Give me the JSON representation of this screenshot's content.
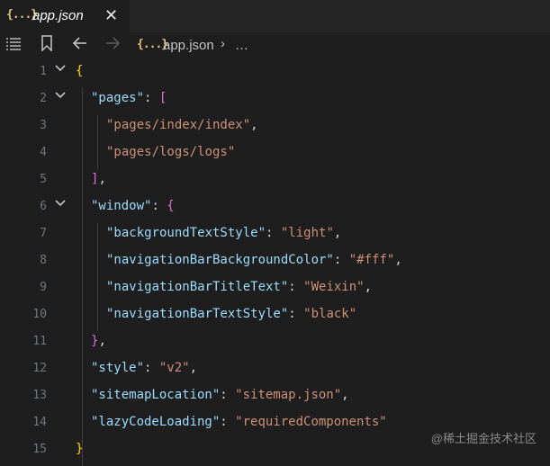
{
  "tab": {
    "icon": "{...}",
    "title": "app.json",
    "close": "✕"
  },
  "breadcrumb": {
    "icon": "{...}",
    "file": "app.json",
    "separator": "›",
    "more": "…"
  },
  "colors": {
    "background": "#1e1e1e",
    "key": "#9cdcfe",
    "string": "#ce9178",
    "bracket_gold": "#ffd700",
    "bracket_purple": "#da70d6",
    "line_number": "#6e7681"
  },
  "lines": [
    {
      "n": "1",
      "fold": true,
      "indent": 0,
      "parts": [
        {
          "t": "{",
          "c": "br1"
        }
      ]
    },
    {
      "n": "2",
      "fold": true,
      "indent": 1,
      "parts": [
        {
          "t": "\"pages\"",
          "c": "key"
        },
        {
          "t": ": ",
          "c": "punc"
        },
        {
          "t": "[",
          "c": "br2"
        }
      ]
    },
    {
      "n": "3",
      "fold": false,
      "indent": 2,
      "parts": [
        {
          "t": "\"pages/index/index\"",
          "c": "str"
        },
        {
          "t": ",",
          "c": "punc"
        }
      ]
    },
    {
      "n": "4",
      "fold": false,
      "indent": 2,
      "parts": [
        {
          "t": "\"pages/logs/logs\"",
          "c": "str"
        }
      ]
    },
    {
      "n": "5",
      "fold": false,
      "indent": 1,
      "parts": [
        {
          "t": "]",
          "c": "br2"
        },
        {
          "t": ",",
          "c": "punc"
        }
      ]
    },
    {
      "n": "6",
      "fold": true,
      "indent": 1,
      "parts": [
        {
          "t": "\"window\"",
          "c": "key"
        },
        {
          "t": ": ",
          "c": "punc"
        },
        {
          "t": "{",
          "c": "br2"
        }
      ]
    },
    {
      "n": "7",
      "fold": false,
      "indent": 2,
      "parts": [
        {
          "t": "\"backgroundTextStyle\"",
          "c": "key"
        },
        {
          "t": ": ",
          "c": "punc"
        },
        {
          "t": "\"light\"",
          "c": "str"
        },
        {
          "t": ",",
          "c": "punc"
        }
      ]
    },
    {
      "n": "8",
      "fold": false,
      "indent": 2,
      "parts": [
        {
          "t": "\"navigationBarBackgroundColor\"",
          "c": "key"
        },
        {
          "t": ": ",
          "c": "punc"
        },
        {
          "t": "\"#fff\"",
          "c": "str"
        },
        {
          "t": ",",
          "c": "punc"
        }
      ]
    },
    {
      "n": "9",
      "fold": false,
      "indent": 2,
      "parts": [
        {
          "t": "\"navigationBarTitleText\"",
          "c": "key"
        },
        {
          "t": ": ",
          "c": "punc"
        },
        {
          "t": "\"Weixin\"",
          "c": "str"
        },
        {
          "t": ",",
          "c": "punc"
        }
      ]
    },
    {
      "n": "10",
      "fold": false,
      "indent": 2,
      "parts": [
        {
          "t": "\"navigationBarTextStyle\"",
          "c": "key"
        },
        {
          "t": ": ",
          "c": "punc"
        },
        {
          "t": "\"black\"",
          "c": "str"
        }
      ]
    },
    {
      "n": "11",
      "fold": false,
      "indent": 1,
      "parts": [
        {
          "t": "}",
          "c": "br2"
        },
        {
          "t": ",",
          "c": "punc"
        }
      ]
    },
    {
      "n": "12",
      "fold": false,
      "indent": 1,
      "parts": [
        {
          "t": "\"style\"",
          "c": "key"
        },
        {
          "t": ": ",
          "c": "punc"
        },
        {
          "t": "\"v2\"",
          "c": "str"
        },
        {
          "t": ",",
          "c": "punc"
        }
      ]
    },
    {
      "n": "13",
      "fold": false,
      "indent": 1,
      "parts": [
        {
          "t": "\"sitemapLocation\"",
          "c": "key"
        },
        {
          "t": ": ",
          "c": "punc"
        },
        {
          "t": "\"sitemap.json\"",
          "c": "str"
        },
        {
          "t": ",",
          "c": "punc"
        }
      ]
    },
    {
      "n": "14",
      "fold": false,
      "indent": 1,
      "parts": [
        {
          "t": "\"lazyCodeLoading\"",
          "c": "key"
        },
        {
          "t": ": ",
          "c": "punc"
        },
        {
          "t": "\"requiredComponents\"",
          "c": "str"
        }
      ]
    },
    {
      "n": "15",
      "fold": false,
      "indent": 0,
      "parts": [
        {
          "t": "}",
          "c": "br1"
        }
      ]
    }
  ],
  "watermark": "@稀土掘金技术社区"
}
